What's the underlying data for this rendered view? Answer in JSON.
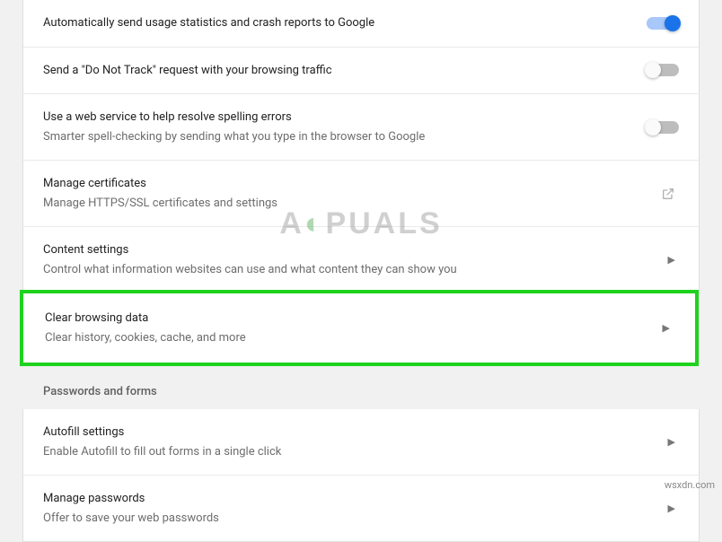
{
  "privacy": {
    "crash_reports": {
      "title": "Automatically send usage statistics and crash reports to Google",
      "enabled": true
    },
    "do_not_track": {
      "title": "Send a \"Do Not Track\" request with your browsing traffic",
      "enabled": false
    },
    "spelling": {
      "title": "Use a web service to help resolve spelling errors",
      "subtitle": "Smarter spell-checking by sending what you type in the browser to Google",
      "enabled": false
    },
    "certificates": {
      "title": "Manage certificates",
      "subtitle": "Manage HTTPS/SSL certificates and settings"
    },
    "content": {
      "title": "Content settings",
      "subtitle": "Control what information websites can use and what content they can show you"
    },
    "clear_data": {
      "title": "Clear browsing data",
      "subtitle": "Clear history, cookies, cache, and more"
    }
  },
  "passwords_section": {
    "header": "Passwords and forms",
    "autofill": {
      "title": "Autofill settings",
      "subtitle": "Enable Autofill to fill out forms in a single click"
    },
    "manage_passwords": {
      "title": "Manage passwords",
      "subtitle": "Offer to save your web passwords"
    }
  },
  "watermark_text": "A◐PUALS",
  "footer": "wsxdn.com"
}
